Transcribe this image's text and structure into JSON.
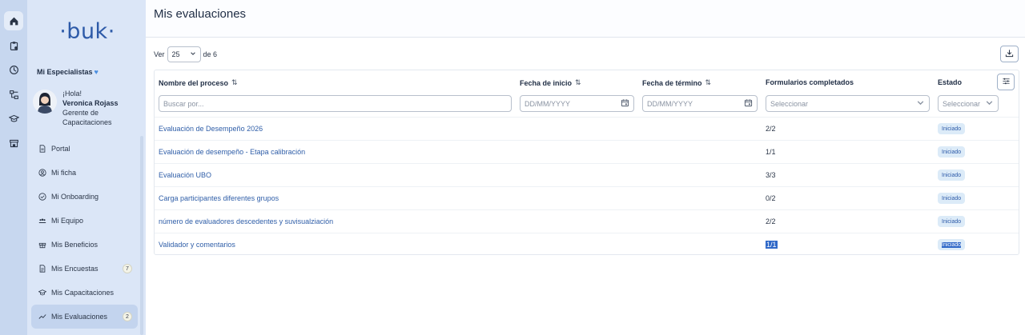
{
  "rail": {
    "icons": [
      "home-icon",
      "clipboard-icon",
      "clock-icon",
      "org-chart-icon",
      "graduation-cap-icon",
      "store-icon"
    ]
  },
  "sidebar": {
    "logo": "·buk·",
    "org_name": "Mi Especialistas",
    "user": {
      "greeting": "¡Hola!",
      "name": "Veronica Rojass",
      "role": "Gerente de Capacitaciones"
    },
    "items": [
      {
        "label": "Portal",
        "icon": "document-icon",
        "badge": ""
      },
      {
        "label": "Mi ficha",
        "icon": "user-circle-icon",
        "badge": ""
      },
      {
        "label": "Mi Onboarding",
        "icon": "check-circle-icon",
        "badge": ""
      },
      {
        "label": "Mi Equipo",
        "icon": "team-icon",
        "badge": ""
      },
      {
        "label": "Mis Beneficios",
        "icon": "gift-icon",
        "badge": ""
      },
      {
        "label": "Mis Encuestas",
        "icon": "survey-icon",
        "badge": "7"
      },
      {
        "label": "Mis Capacitaciones",
        "icon": "graduation-cap-icon",
        "badge": ""
      },
      {
        "label": "Mis Evaluaciones",
        "icon": "trend-icon",
        "badge": "2",
        "active": true
      }
    ]
  },
  "main": {
    "title": "Mis evaluaciones",
    "toolbar": {
      "ver_label": "Ver",
      "page_size": "25",
      "of_label": "de 6"
    },
    "table": {
      "columns": [
        {
          "label": "Nombre del proceso",
          "sortable": true
        },
        {
          "label": "Fecha de inicio",
          "sortable": true
        },
        {
          "label": "Fecha de término",
          "sortable": true
        },
        {
          "label": "Formularios completados",
          "sortable": false
        },
        {
          "label": "Estado",
          "sortable": false
        }
      ],
      "filters": {
        "search_placeholder": "Buscar por...",
        "start_placeholder": "DD/MM/YYYY",
        "end_placeholder": "DD/MM/YYYY",
        "forms_placeholder": "Seleccionar",
        "status_placeholder": "Seleccionar"
      },
      "rows": [
        {
          "process": "Evaluación de Desempeño 2026",
          "forms": "2/2",
          "status": "Iniciado"
        },
        {
          "process": "Evaluación de desempeño - Etapa calibración",
          "forms": "1/1",
          "status": "Iniciado"
        },
        {
          "process": "Evaluación UBO",
          "forms": "3/3",
          "status": "Iniciado"
        },
        {
          "process": "Carga participantes diferentes grupos",
          "forms": "0/2",
          "status": "Iniciado"
        },
        {
          "process": "número de evaluadores descedentes y suvisualziación",
          "forms": "2/2",
          "status": "Iniciado"
        },
        {
          "process": "Validador y comentarios",
          "forms": "1/1",
          "status": "Iniciado"
        }
      ]
    }
  },
  "colors": {
    "rail_bg": "#c7d7ef",
    "sidebar_bg": "#dbe6f7",
    "brand_blue": "#2d5aa8",
    "link_blue": "#2f5ea8",
    "status_bg": "#dcebf8",
    "selection": "#2f68c8"
  }
}
